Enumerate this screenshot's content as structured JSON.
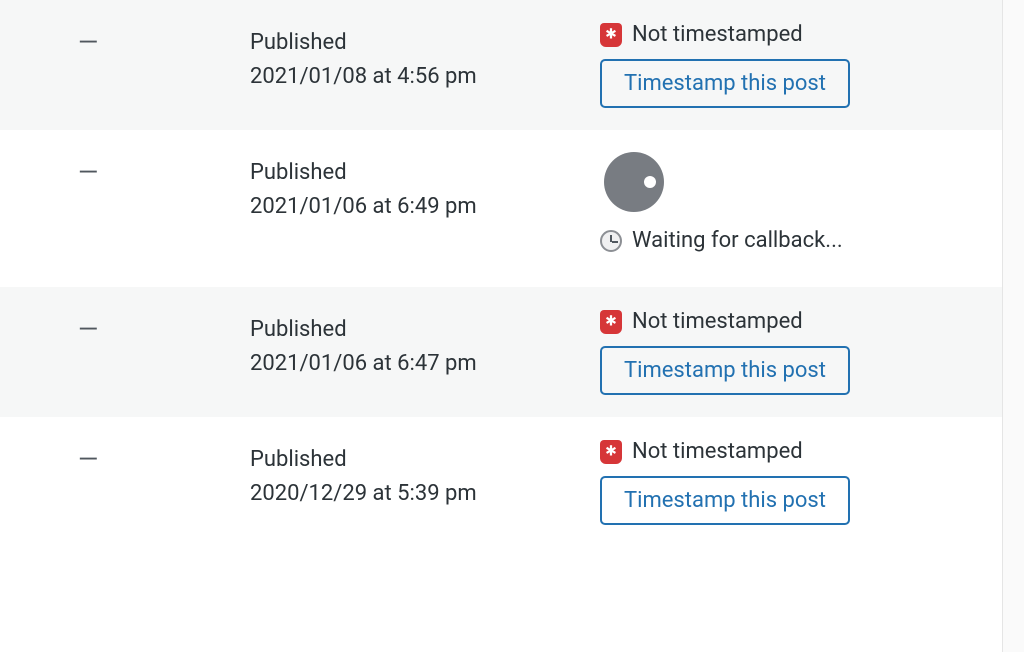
{
  "rows": [
    {
      "title_placeholder": "—",
      "status": "Published",
      "date": "2021/01/08 at 4:56 pm",
      "stamp_status": "Not timestamped",
      "button_label": "Timestamp this post"
    },
    {
      "title_placeholder": "—",
      "status": "Published",
      "date": "2021/01/06 at 6:49 pm",
      "waiting_text": "Waiting for callback..."
    },
    {
      "title_placeholder": "—",
      "status": "Published",
      "date": "2021/01/06 at 6:47 pm",
      "stamp_status": "Not timestamped",
      "button_label": "Timestamp this post"
    },
    {
      "title_placeholder": "—",
      "status": "Published",
      "date": "2020/12/29 at 5:39 pm",
      "stamp_status": "Not timestamped",
      "button_label": "Timestamp this post"
    }
  ]
}
